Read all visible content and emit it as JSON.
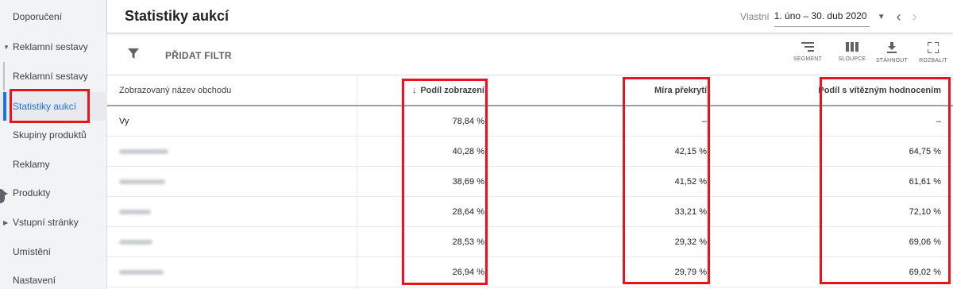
{
  "sidebar": {
    "items": [
      {
        "label": "Doporučení"
      },
      {
        "label": "Reklamní sestavy"
      },
      {
        "label": "Reklamní sestavy"
      },
      {
        "label": "Statistiky aukcí"
      },
      {
        "label": "Skupiny produktů"
      },
      {
        "label": "Reklamy"
      },
      {
        "label": "Produkty"
      },
      {
        "label": "Vstupní stránky"
      },
      {
        "label": "Umístění"
      },
      {
        "label": "Nastavení"
      }
    ]
  },
  "header": {
    "title": "Statistiky aukcí",
    "range_type": "Vlastní",
    "range_value": "1. úno – 30. dub 2020"
  },
  "toolbar": {
    "add_filter": "PŘIDAT FILTR",
    "segment": "SEGMENT",
    "columns": "SLOUPCE",
    "download": "STÁHNOUT",
    "expand": "ROZBALIT"
  },
  "table": {
    "headers": {
      "name": "Zobrazovaný název obchodu",
      "impr_share": "Podíl zobrazení",
      "overlap": "Míra překrytí",
      "outranking": "Podíl s vítězným hodnocením"
    },
    "rows": [
      {
        "name": "Vy",
        "impr_share": "78,84 %",
        "overlap": "–",
        "outranking": "–"
      },
      {
        "name": "",
        "impr_share": "40,28 %",
        "overlap": "42,15 %",
        "outranking": "64,75 %"
      },
      {
        "name": "",
        "impr_share": "38,69 %",
        "overlap": "41,52 %",
        "outranking": "61,61 %"
      },
      {
        "name": "",
        "impr_share": "28,64 %",
        "overlap": "33,21 %",
        "outranking": "72,10 %"
      },
      {
        "name": "",
        "impr_share": "28,53 %",
        "overlap": "29,32 %",
        "outranking": "69,06 %"
      },
      {
        "name": "",
        "impr_share": "26,94 %",
        "overlap": "29,79 %",
        "outranking": "69,02 %"
      }
    ]
  },
  "colors": {
    "accent": "#1a73e8",
    "highlight": "#e8131c"
  }
}
